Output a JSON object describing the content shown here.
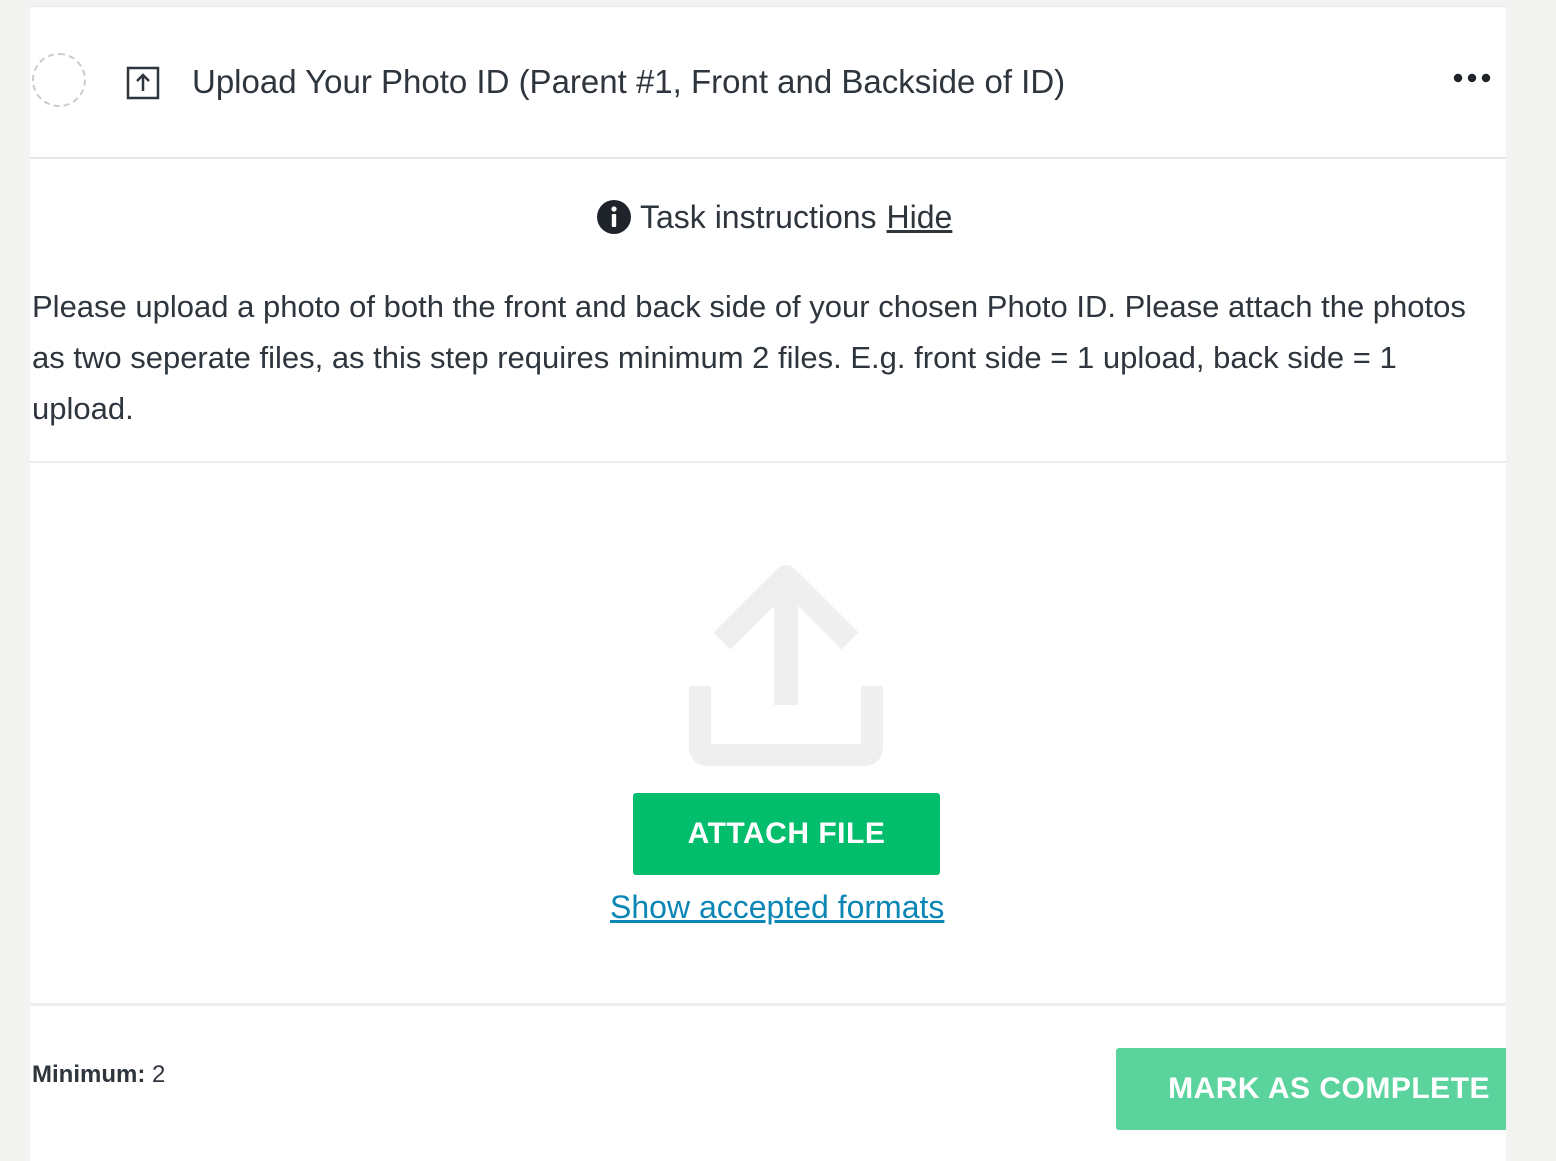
{
  "task": {
    "title": "Upload Your Photo ID (Parent #1, Front and Backside of ID)",
    "status": "incomplete",
    "type_icon": "upload-box-icon",
    "more_icon": "more-horizontal-icon"
  },
  "instructions": {
    "icon": "info-icon",
    "label": "Task instructions",
    "toggle_link": "Hide",
    "text": "Please upload a photo of both the front and back side of your chosen Photo ID. Please attach the photos as two seperate files, as this step requires minimum 2 files. E.g. front side = 1 upload, back side = 1 upload."
  },
  "upload": {
    "icon": "upload-arrow-icon",
    "attach_button": "ATTACH FILE",
    "formats_link": "Show accepted formats"
  },
  "footer": {
    "minimum_label": "Minimum:",
    "minimum_value": "2",
    "complete_button": "MARK AS COMPLETE"
  },
  "colors": {
    "primary_green": "#02bd6c",
    "disabled_green": "#5bd39d",
    "link_blue": "#0b86b5",
    "text": "#2f353d",
    "background": "#f3f3f2"
  }
}
